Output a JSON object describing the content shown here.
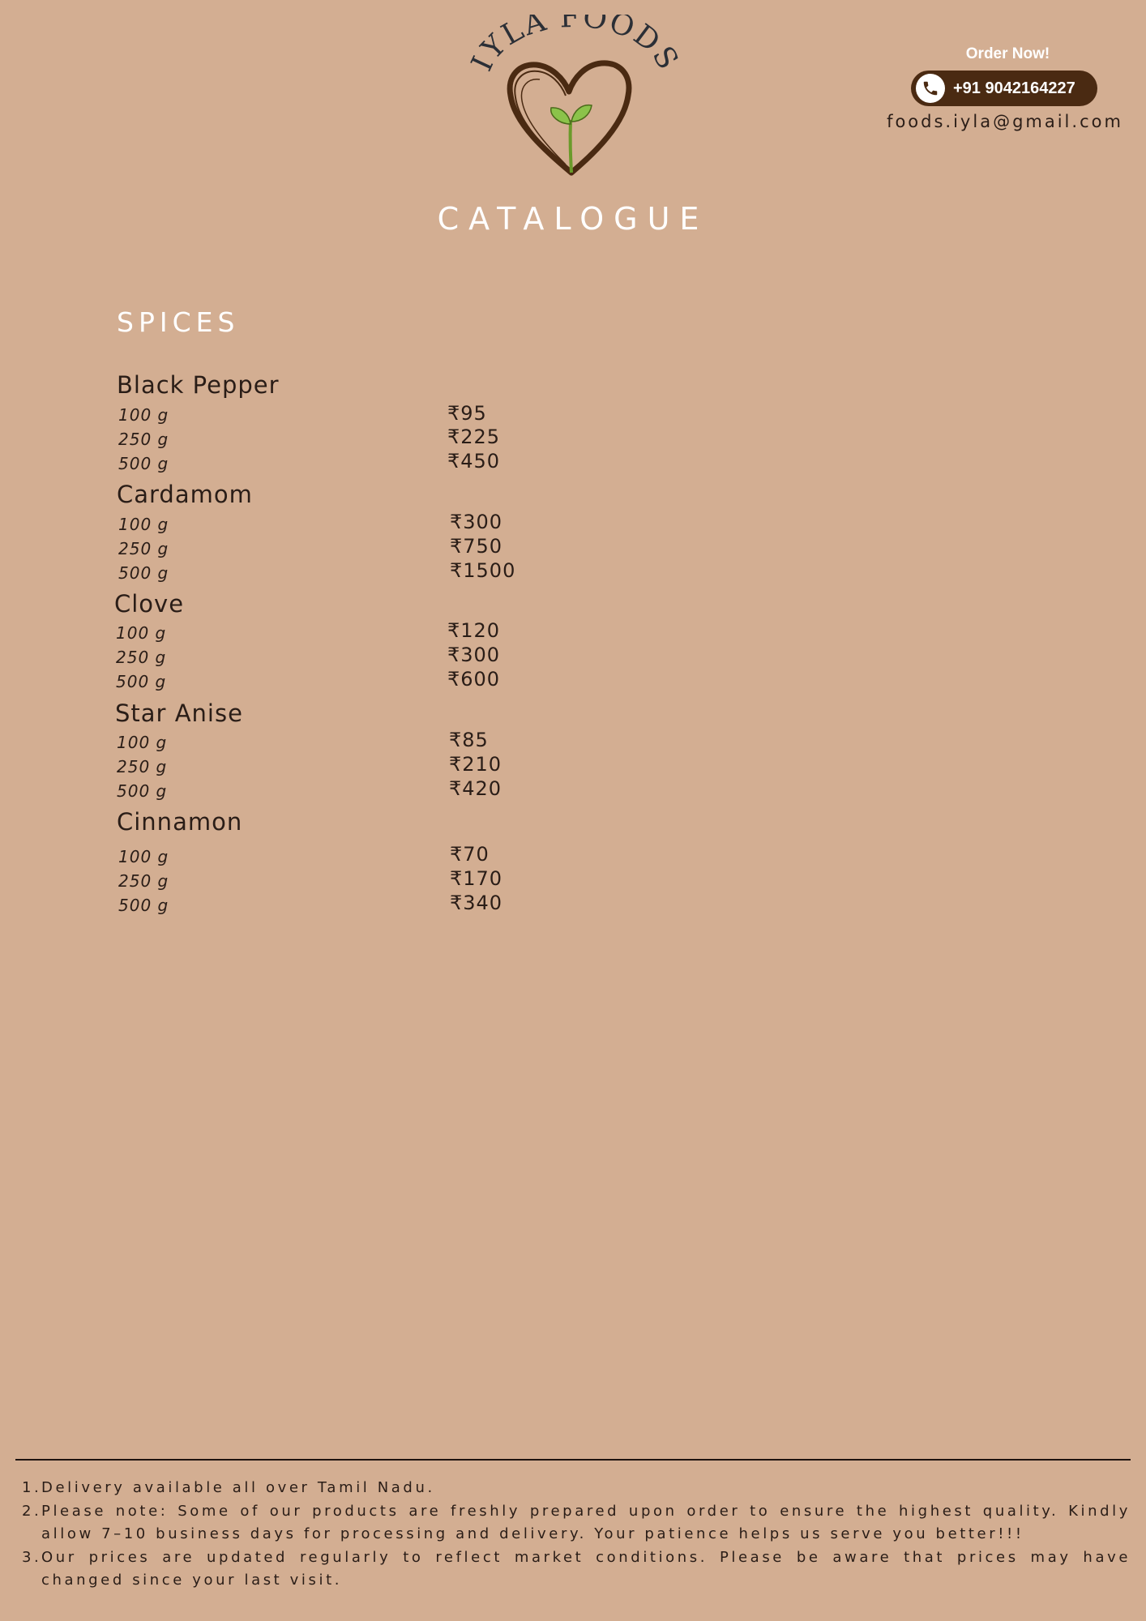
{
  "header": {
    "brand": "IYLA FOODS",
    "title": "CATALOGUE"
  },
  "contact": {
    "order_label": "Order Now!",
    "phone": "+91 9042164227",
    "email": "foods.iyla@gmail.com",
    "pill_color": "#4a2a12"
  },
  "section": {
    "title": "SPICES",
    "products": [
      {
        "name": "Black Pepper",
        "options": [
          {
            "size": "100 g",
            "price": "₹95"
          },
          {
            "size": "250 g",
            "price": "₹225"
          },
          {
            "size": "500 g",
            "price": "₹450"
          }
        ]
      },
      {
        "name": "Cardamom",
        "options": [
          {
            "size": "100 g",
            "price": "₹300"
          },
          {
            "size": "250 g",
            "price": "₹750"
          },
          {
            "size": "500 g",
            "price": "₹1500"
          }
        ]
      },
      {
        "name": "Clove",
        "options": [
          {
            "size": "100 g",
            "price": "₹120"
          },
          {
            "size": "250 g",
            "price": "₹300"
          },
          {
            "size": "500 g",
            "price": "₹600"
          }
        ]
      },
      {
        "name": "Star Anise",
        "options": [
          {
            "size": "100 g",
            "price": "₹85"
          },
          {
            "size": "250 g",
            "price": "₹210"
          },
          {
            "size": "500 g",
            "price": "₹420"
          }
        ]
      },
      {
        "name": "Cinnamon",
        "options": [
          {
            "size": "100 g",
            "price": "₹70"
          },
          {
            "size": "250 g",
            "price": "₹170"
          },
          {
            "size": "500 g",
            "price": "₹340"
          }
        ]
      }
    ]
  },
  "notes": [
    "Delivery available all over Tamil Nadu.",
    "Please note: Some of our products are freshly prepared upon order to ensure the highest quality. Kindly allow 7–10 business days for processing and delivery. Your patience helps us serve you better!!!",
    "Our prices are updated regularly to reflect market conditions. Please be aware that prices may have changed since your last visit."
  ],
  "colors": {
    "background": "#d3ae92",
    "heading": "#ffffff",
    "text": "#2a1d17"
  }
}
